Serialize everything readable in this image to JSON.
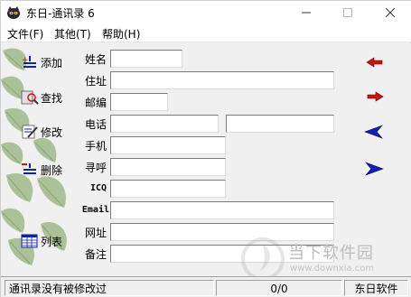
{
  "window": {
    "title": "东日-通讯录 6"
  },
  "menu": [
    "文件(F)",
    "其他(T)",
    "帮助(H)"
  ],
  "side_buttons": {
    "add": "添加",
    "find": "查找",
    "edit": "修改",
    "delete": "删除",
    "list": "列表"
  },
  "fields": {
    "name": {
      "label": "姓名",
      "value": ""
    },
    "address": {
      "label": "住址",
      "value": ""
    },
    "postcode": {
      "label": "邮编",
      "value": ""
    },
    "phone": {
      "label": "电话",
      "value": "",
      "value2": ""
    },
    "mobile": {
      "label": "手机",
      "value": ""
    },
    "pager": {
      "label": "寻呼",
      "value": ""
    },
    "icq": {
      "label": "ICQ",
      "value": ""
    },
    "email": {
      "label": "Email",
      "value": ""
    },
    "website": {
      "label": "网址",
      "value": ""
    },
    "note": {
      "label": "备注",
      "value": ""
    }
  },
  "watermark": {
    "brand": "当下软件园",
    "url": "www.downxia.com"
  },
  "status": {
    "message": "通讯录没有被修改过",
    "record": "0/0",
    "company": "东日软件"
  },
  "colors": {
    "accent_red": "#cc1111",
    "accent_blue": "#1020b0"
  }
}
